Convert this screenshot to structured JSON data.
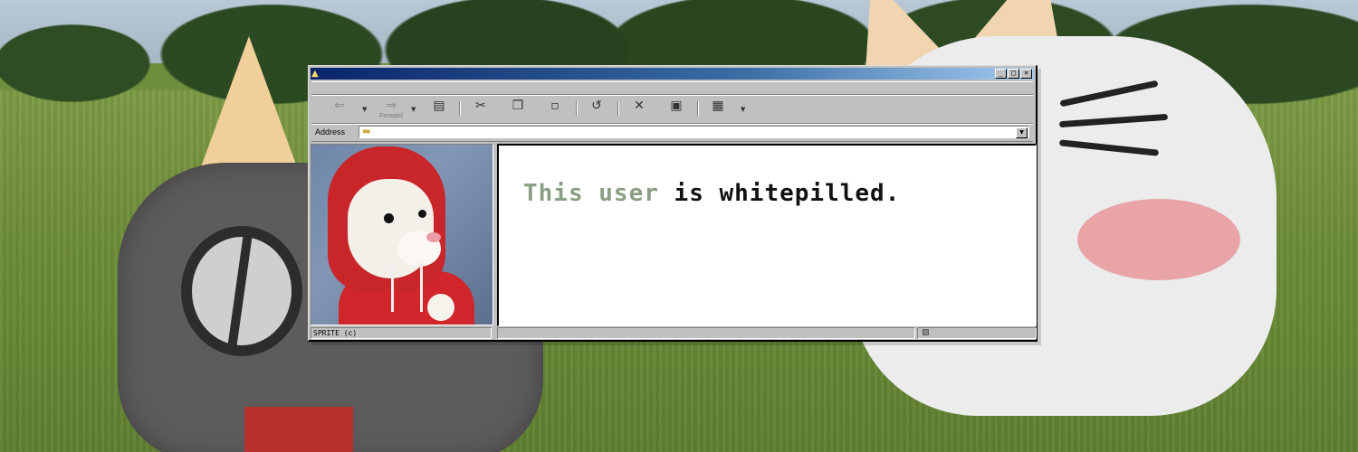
{
  "window": {
    "title": "",
    "controls": {
      "minimize": "_",
      "maximize": "□",
      "close": "×"
    }
  },
  "toolbar": {
    "back_icon": "back-arrow-icon",
    "forward_label": "Forward",
    "forward_icon": "forward-arrow-icon",
    "items": [
      "up-folder-icon",
      "cut-icon",
      "copy-icon",
      "paste-icon",
      "undo-icon",
      "delete-icon",
      "properties-icon",
      "views-icon"
    ]
  },
  "address": {
    "label": "Address",
    "value": ""
  },
  "content": {
    "message_part1": "This user",
    "message_part2": " is whitepilled.",
    "accent_color": "#8a9e83"
  },
  "sidebar": {
    "image_alt": "ferret in red hoodie"
  },
  "status": {
    "left_text": "SPRITE (c)",
    "mid_text": "",
    "right_icon": "computer-icon"
  }
}
